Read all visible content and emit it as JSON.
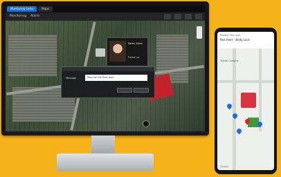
{
  "app": {
    "tabs": [
      {
        "label": "Monitoring tasks"
      },
      {
        "label": "Maps"
      }
    ],
    "toolbar": {
      "items": [
        "Monitoring",
        "Alarm"
      ]
    }
  },
  "person_card": {
    "name": "Karen Alves",
    "subtitle": "Follow up"
  },
  "dialog": {
    "label": "Message",
    "input_value": "Resume the floor plan"
  },
  "phone": {
    "header_line1": "Position the user",
    "header_line2": "Red Alert - Body Lock",
    "label": "Toledo Campus",
    "google": "Google"
  },
  "colors": {
    "background": "#F6B21A",
    "tab_active": "#1d6fd0",
    "building_red": "#c4222a"
  }
}
